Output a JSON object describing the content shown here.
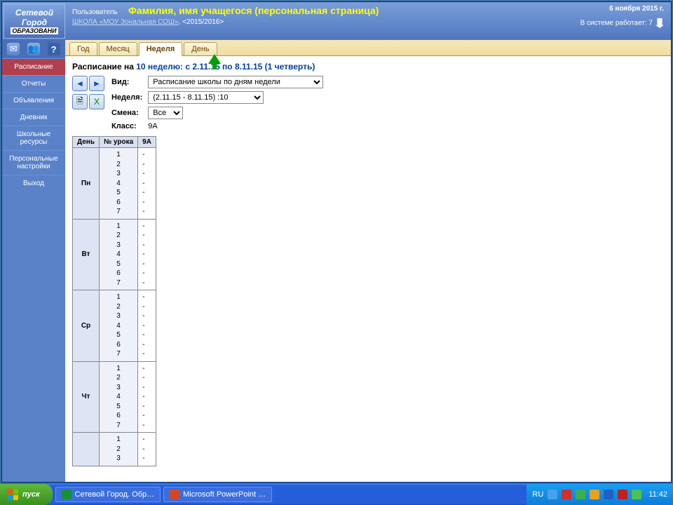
{
  "header": {
    "logo_l1": "Сетевой",
    "logo_l2": "Город",
    "logo_l3": "ОБРАЗОВАНИ",
    "user_label": "Пользователь",
    "title": "Фамилия, имя учащегося (персональная страница)",
    "school_link": "ШКОЛА «МОУ Зональная СОШ»",
    "year": ", <2015/2016>",
    "date": "6 ноября 2015 г.",
    "sys_label": "В системе работает: 7"
  },
  "nav": {
    "items": [
      "Расписание",
      "Отчеты",
      "Объявления",
      "Дневник",
      "Школьные ресурсы",
      "Персональные настройки",
      "Выход"
    ],
    "active_index": 0
  },
  "tabs": {
    "items": [
      "Год",
      "Месяц",
      "Неделя",
      "День"
    ],
    "active_index": 2
  },
  "page": {
    "title_prefix": "Расписание на ",
    "title_week": "10 неделю: ",
    "title_range": "с 2.11.15 по 8.11.15 (1 четверть)",
    "view_label": "Вид:",
    "view_value": "Расписание школы по дням недели",
    "week_label": "Неделя:",
    "week_value": "(2.11.15 - 8.11.15) :10",
    "shift_label": "Смена:",
    "shift_value": "Все",
    "class_label": "Класс:",
    "class_value": "9А"
  },
  "table": {
    "headers": [
      "День",
      "№ урока",
      "9А"
    ],
    "days": [
      {
        "name": "Пн",
        "lessons": [
          "1",
          "2",
          "3",
          "4",
          "5",
          "6",
          "7"
        ],
        "vals": [
          "-",
          "-",
          "-",
          "-",
          "-",
          "-",
          "-"
        ]
      },
      {
        "name": "Вт",
        "lessons": [
          "1",
          "2",
          "3",
          "4",
          "5",
          "6",
          "7"
        ],
        "vals": [
          "-",
          "-",
          "-",
          "-",
          "-",
          "-",
          "-"
        ]
      },
      {
        "name": "Ср",
        "lessons": [
          "1",
          "2",
          "3",
          "4",
          "5",
          "6",
          "7"
        ],
        "vals": [
          "-",
          "-",
          "-",
          "-",
          "-",
          "-",
          "-"
        ]
      },
      {
        "name": "Чт",
        "lessons": [
          "1",
          "2",
          "3",
          "4",
          "5",
          "6",
          "7"
        ],
        "vals": [
          "-",
          "-",
          "-",
          "-",
          "-",
          "-",
          "-"
        ]
      },
      {
        "name": "",
        "lessons": [
          "1",
          "2",
          "3"
        ],
        "vals": [
          "-",
          "-",
          "-"
        ]
      }
    ]
  },
  "taskbar": {
    "start": "пуск",
    "items": [
      {
        "label": "Сетевой Город. Обр…",
        "color": "#1a8f3a"
      },
      {
        "label": "Microsoft PowerPoint …",
        "color": "#d24726"
      }
    ],
    "lang": "RU",
    "clock": "11:42"
  }
}
